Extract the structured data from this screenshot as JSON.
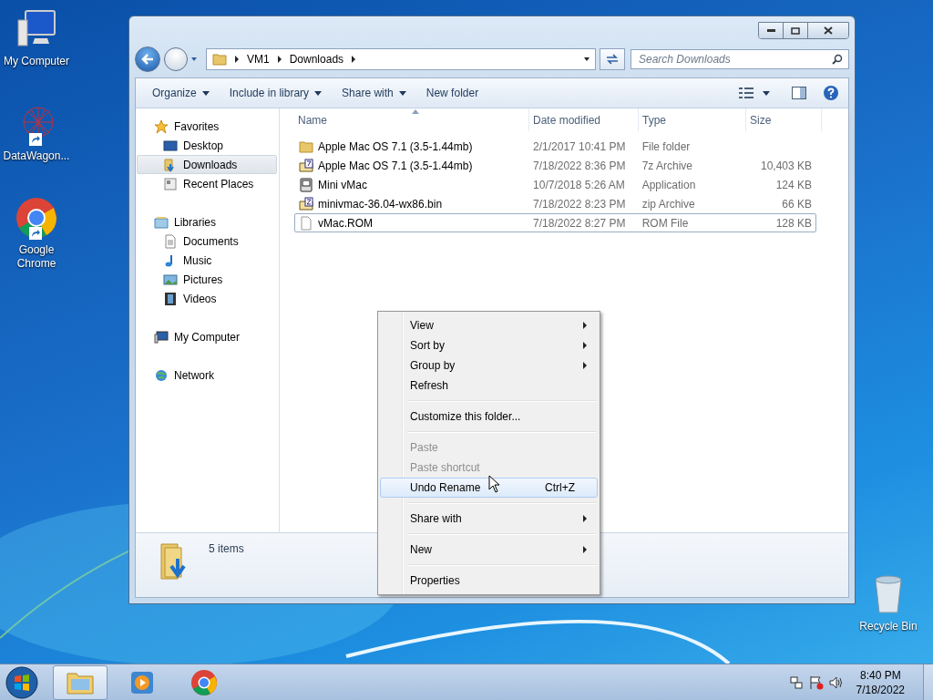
{
  "desktop_icons": [
    {
      "label": "My Computer",
      "kind": "computer",
      "shortcut": false
    },
    {
      "label": "DataWagon...",
      "kind": "network",
      "shortcut": true
    },
    {
      "label": "Google Chrome",
      "kind": "chrome",
      "shortcut": true
    }
  ],
  "desktop_icons_right": [
    {
      "label": "Recycle Bin",
      "kind": "recycle",
      "shortcut": false
    }
  ],
  "window": {
    "address": {
      "crumbs": [
        "VM1",
        "Downloads"
      ]
    },
    "search": {
      "placeholder": "Search Downloads"
    },
    "toolbar": [
      {
        "label": "Organize",
        "dropdown": true
      },
      {
        "label": "Include in library",
        "dropdown": true
      },
      {
        "label": "Share with",
        "dropdown": true
      },
      {
        "label": "New folder",
        "dropdown": false
      }
    ],
    "nav": [
      {
        "label": "Favorites",
        "kind": "star",
        "selected": false,
        "children": [
          {
            "label": "Desktop",
            "kind": "desktop",
            "selected": false
          },
          {
            "label": "Downloads",
            "kind": "downloads",
            "selected": true
          },
          {
            "label": "Recent Places",
            "kind": "recent",
            "selected": false
          }
        ]
      },
      {
        "label": "Libraries",
        "kind": "library",
        "selected": false,
        "children": [
          {
            "label": "Documents",
            "kind": "document",
            "selected": false
          },
          {
            "label": "Music",
            "kind": "music",
            "selected": false
          },
          {
            "label": "Pictures",
            "kind": "pictures",
            "selected": false
          },
          {
            "label": "Videos",
            "kind": "videos",
            "selected": false
          }
        ]
      },
      {
        "label": "My Computer",
        "kind": "computer",
        "selected": false
      },
      {
        "label": "Network",
        "kind": "network",
        "selected": false
      }
    ],
    "columns": [
      {
        "label": "Name",
        "sorted": true
      },
      {
        "label": "Date modified",
        "sorted": false
      },
      {
        "label": "Type",
        "sorted": false
      },
      {
        "label": "Size",
        "sorted": false
      }
    ],
    "files": [
      {
        "kind": "folder",
        "name": "Apple Mac OS 7.1 (3.5-1.44mb)",
        "date": "2/1/2017 10:41 PM",
        "type": "File folder",
        "focused": false
      },
      {
        "kind": "archive",
        "name": "Apple Mac OS 7.1 (3.5-1.44mb)",
        "date": "7/18/2022 8:36 PM",
        "type": "7z Archive",
        "size": "10,403 KB",
        "focused": false
      },
      {
        "kind": "app",
        "name": "Mini vMac",
        "date": "10/7/2018 5:26 AM",
        "type": "Application",
        "size": "124 KB",
        "focused": false
      },
      {
        "kind": "zip",
        "name": "minivmac-36.04-wx86.bin",
        "date": "7/18/2022 8:23 PM",
        "type": "zip Archive",
        "size": "66 KB",
        "focused": false
      },
      {
        "kind": "file",
        "name": "vMac.ROM",
        "date": "7/18/2022 8:27 PM",
        "type": "ROM File",
        "size": "128 KB",
        "focused": true
      }
    ],
    "status": "5 items"
  },
  "context_menu": [
    [
      {
        "label": "View",
        "submenu": true,
        "disabled": false,
        "selected": false
      },
      {
        "label": "Sort by",
        "submenu": true,
        "disabled": false,
        "selected": false
      },
      {
        "label": "Group by",
        "submenu": true,
        "disabled": false,
        "selected": false
      },
      {
        "label": "Refresh",
        "submenu": false,
        "disabled": false,
        "selected": false
      }
    ],
    [
      {
        "label": "Customize this folder...",
        "submenu": false,
        "disabled": false,
        "selected": false
      }
    ],
    [
      {
        "label": "Paste",
        "submenu": false,
        "disabled": true,
        "selected": false
      },
      {
        "label": "Paste shortcut",
        "submenu": false,
        "disabled": true,
        "selected": false
      },
      {
        "label": "Undo Rename",
        "shortcut": "Ctrl+Z",
        "submenu": false,
        "disabled": false,
        "selected": true
      }
    ],
    [
      {
        "label": "Share with",
        "submenu": true,
        "disabled": false,
        "selected": false
      }
    ],
    [
      {
        "label": "New",
        "submenu": true,
        "disabled": false,
        "selected": false
      }
    ],
    [
      {
        "label": "Properties",
        "submenu": false,
        "disabled": false,
        "selected": false
      }
    ]
  ],
  "taskbar": {
    "apps": [
      {
        "kind": "explorer",
        "active": true
      },
      {
        "kind": "media",
        "active": false
      },
      {
        "kind": "chrome",
        "active": false
      }
    ],
    "time": "8:40 PM",
    "date": "7/18/2022"
  }
}
